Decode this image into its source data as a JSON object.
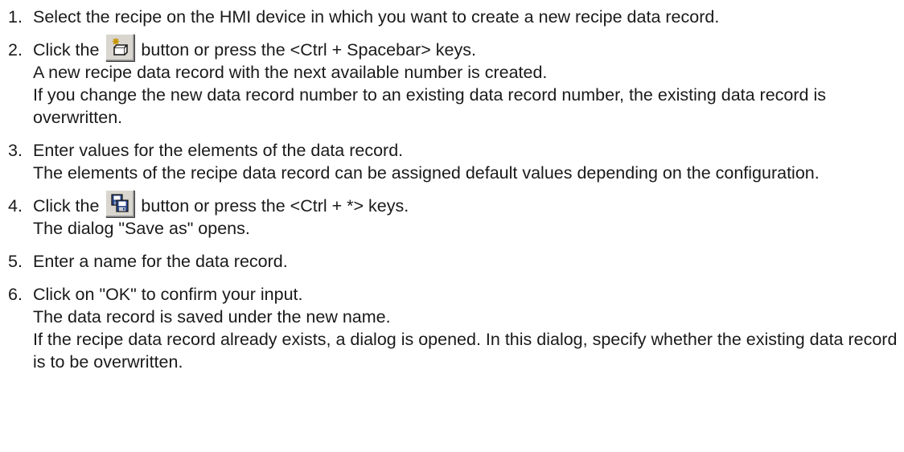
{
  "steps": [
    {
      "number": "1.",
      "lines": [
        "Select the recipe on the HMI device in which you want to create a new recipe data record."
      ]
    },
    {
      "number": "2.",
      "lead_before": "Click the",
      "lead_after": "button or press the <Ctrl + Spacebar> keys.",
      "icon": "new-record-icon",
      "lines": [
        "A new recipe data record with the next available number is created.",
        "If you change the new data record number to an existing data record number, the existing data record is overwritten."
      ]
    },
    {
      "number": "3.",
      "lines": [
        "Enter values for the elements of the data record.",
        "The elements of the recipe data record can be assigned default values depending on the configuration."
      ]
    },
    {
      "number": "4.",
      "lead_before": "Click the",
      "lead_after": "button or press the <Ctrl + *> keys.",
      "icon": "save-as-icon",
      "lines": [
        "The dialog \"Save as\" opens."
      ]
    },
    {
      "number": "5.",
      "lines": [
        "Enter a name for the data record."
      ]
    },
    {
      "number": "6.",
      "lines": [
        "Click on \"OK\" to confirm your input.",
        "The data record is saved under the new name.",
        "If the recipe data record already exists, a dialog is opened. In this dialog, specify whether the existing data record is to be overwritten."
      ]
    }
  ]
}
